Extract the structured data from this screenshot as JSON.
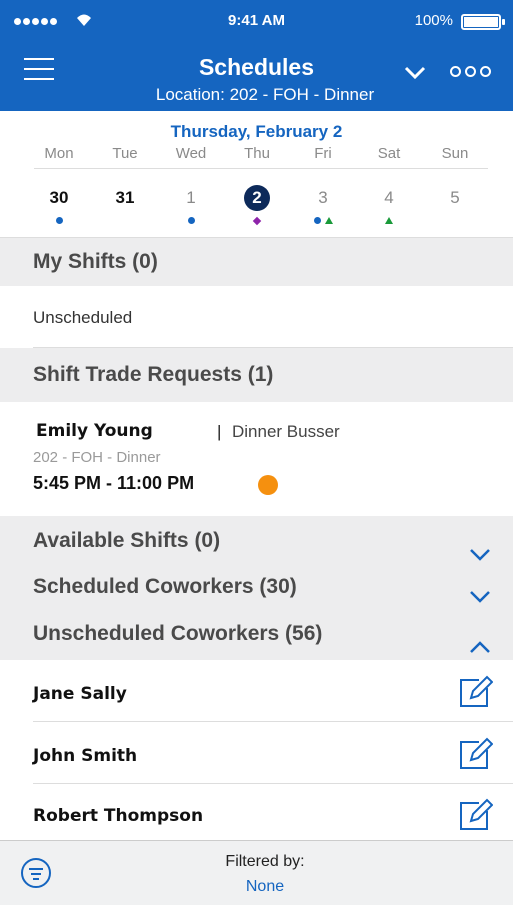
{
  "status_bar": {
    "time": "9:41 AM",
    "battery": "100%"
  },
  "nav": {
    "title": "Schedules",
    "subtitle": "Location: 202 - FOH - Dinner"
  },
  "calendar": {
    "selected_date": "Thursday, February 2",
    "weekdays": [
      "Mon",
      "Tue",
      "Wed",
      "Thu",
      "Fri",
      "Sat",
      "Sun"
    ],
    "days": [
      "30",
      "31",
      "1",
      "2",
      "3",
      "4",
      "5"
    ]
  },
  "my_shifts": {
    "header": "My Shifts (0)",
    "empty_text": "Unscheduled"
  },
  "trade_requests": {
    "header": "Shift Trade Requests (1)",
    "item": {
      "name": "Emily Young",
      "separator": "|",
      "role": "Dinner Busser",
      "location": "202 - FOH - Dinner",
      "time": "5:45 PM - 11:00 PM",
      "status_color": "#f5900f"
    }
  },
  "available_shifts": {
    "header": "Available Shifts (0)"
  },
  "scheduled_coworkers": {
    "header": "Scheduled Coworkers (30)"
  },
  "unscheduled_coworkers": {
    "header": "Unscheduled Coworkers (56)",
    "items": [
      {
        "name": "Jane  Sally"
      },
      {
        "name": "John  Smith"
      },
      {
        "name": "Robert  Thompson"
      }
    ]
  },
  "footer": {
    "filter_label": "Filtered by:",
    "filter_value": "None"
  },
  "colors": {
    "brand": "#1565c0",
    "selected_day": "#0d2a5a",
    "section_bg": "#ededee"
  }
}
